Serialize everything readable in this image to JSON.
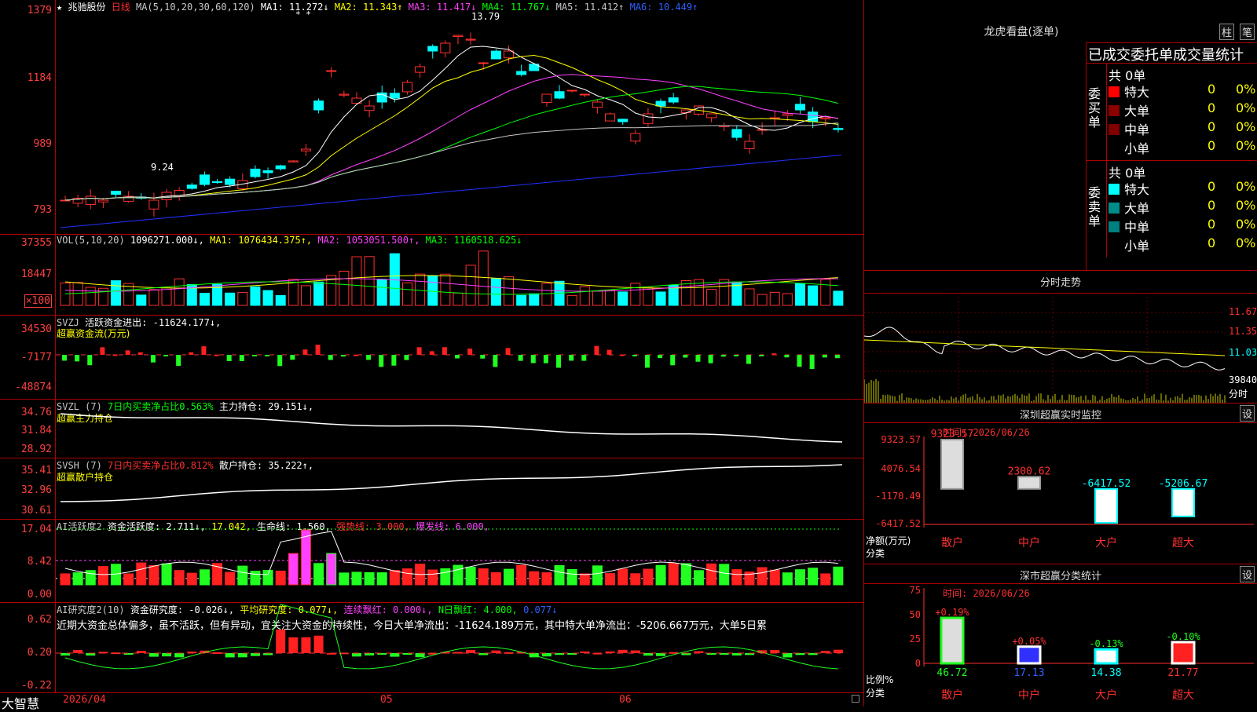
{
  "stock": {
    "star": "★",
    "name": "兆驰股份",
    "period": "日线"
  },
  "ma_header": {
    "label": "MA(5,10,20,30,60,120)",
    "ma1": "MA1: 11.272↓",
    "ma2": "MA2: 11.343↑",
    "ma3": "MA3: 11.417↓",
    "ma4": "MA4: 11.767↓",
    "ma5": "MA5: 11.412↑",
    "ma6": "MA6: 10.449↑"
  },
  "price_axis": [
    "1379",
    "1184",
    "989",
    "793"
  ],
  "price_annotations": {
    "high": "13.79",
    "low": "9.24",
    "marks": "* *"
  },
  "vol_header": {
    "label": "VOL(5,10,20)",
    "value": "1096271.000↓,",
    "ma1": "MA1: 1076434.375↑,",
    "ma2": "MA2: 1053051.500↑,",
    "ma3": "MA3: 1160518.625↓"
  },
  "vol_axis": [
    "37355",
    "18447"
  ],
  "vol_unit": "×100",
  "svzj_header": {
    "label": "SVZJ",
    "title": "活跃资金进出: -11624.177↓,",
    "sub": "超赢资金流(万元)"
  },
  "svzj_axis": [
    "34530",
    "-7177",
    "-48874"
  ],
  "svzl_header": {
    "label": "SVZL (7)",
    "desc": "7日内买卖净占比0.563%",
    "value": "主力持仓: 29.151↓,",
    "sub": "超赢主力持仓"
  },
  "svzl_axis": [
    "34.76",
    "31.84",
    "28.92"
  ],
  "svsh_header": {
    "label": "SVSH (7)",
    "desc": "7日内买卖净占比0.812%",
    "value": "散户持仓: 35.222↑,",
    "sub": "超赢散户持仓"
  },
  "svsh_axis": [
    "35.41",
    "32.96",
    "30.61"
  ],
  "ai1_header": {
    "label": "AI活跃度2",
    "a": "资金活跃度: 2.711↓,",
    "b": "17.042,",
    "c": "生命线: 1.560,",
    "d": "强势线: 3.000,",
    "e": "爆发线: 6.000,"
  },
  "ai1_axis": [
    "17.04",
    "8.42",
    "0.00"
  ],
  "ai2_header": {
    "label": "AI研究度2(10)",
    "a": "资金研究度: -0.026↓,",
    "b": "平均研究度: 0.077↓,",
    "c": "连续飘红: 0.000↓,",
    "d": "N日飘红: 4.000,",
    "e": "0.077↓"
  },
  "ai2_axis": [
    "0.62",
    "0.20",
    "-0.22"
  ],
  "ai2_text": "近期大资金总体偏多，虽不活跃，但有异动，宜关注大资金的持续性，今日大单净流出：-11624.189万元，其中特大单净流出：-5206.667万元，大单5日累",
  "date_axis": {
    "start": "2026/04",
    "m1": "05",
    "m2": "06"
  },
  "brand": "大智慧",
  "lhb": {
    "title": "龙虎看盘(逐单)",
    "btn1": "柱",
    "btn2": "笔",
    "sub": "已成交委托单成交量统计",
    "buy_label": "委买单",
    "sell_label": "委卖单",
    "buy_total": "共 0单",
    "sell_total": "共 0单",
    "buy_rows": [
      {
        "name": "特大",
        "val": "0",
        "pct": "0%"
      },
      {
        "name": "大单",
        "val": "0",
        "pct": "0%"
      },
      {
        "name": "中单",
        "val": "0",
        "pct": "0%"
      },
      {
        "name": "小单",
        "val": "0",
        "pct": "0%"
      }
    ],
    "sell_rows": [
      {
        "name": "特大",
        "val": "0",
        "pct": "0%"
      },
      {
        "name": "大单",
        "val": "0",
        "pct": "0%"
      },
      {
        "name": "中单",
        "val": "0",
        "pct": "0%"
      },
      {
        "name": "小单",
        "val": "0",
        "pct": "0%"
      }
    ],
    "colors": {
      "buy": [
        "#ff0000",
        "#8b0000",
        "#800000"
      ],
      "sell": [
        "#00ffff",
        "#008b8b",
        "#008080"
      ]
    }
  },
  "fenshi": {
    "title": "分时走势",
    "axis": [
      "11.67",
      "11.35",
      "11.03"
    ],
    "vol": "39840",
    "label": "分时"
  },
  "monitor": {
    "title": "深圳超赢实时监控",
    "btn": "设",
    "time": "时间: 2026/06/26",
    "axis": [
      "9323.57",
      "4076.54",
      "-1170.49",
      "-6417.52"
    ],
    "ylabel": "净额(万元)",
    "xlabel": "分类",
    "cats": [
      "散户",
      "中户",
      "大户",
      "超大"
    ],
    "values": [
      "9323.57",
      "2300.62",
      "-6417.52",
      "-5206.67"
    ]
  },
  "classify": {
    "title": "深市超赢分类统计",
    "btn": "设",
    "time": "时间: 2026/06/26",
    "axis": [
      "75",
      "50",
      "25",
      "0"
    ],
    "ylabel": "比例%",
    "xlabel": "分类",
    "cats": [
      "散户",
      "中户",
      "大户",
      "超大"
    ],
    "top": [
      "+0.19%",
      "+0.05%",
      "-0.13%",
      "-0.10%"
    ],
    "bottom": [
      "46.72",
      "17.13",
      "14.38",
      "21.77"
    ]
  },
  "chart_data": [
    {
      "type": "bar",
      "title": "深圳超赢实时监控",
      "categories": [
        "散户",
        "中户",
        "大户",
        "超大"
      ],
      "values": [
        9323.57,
        2300.62,
        -6417.52,
        -5206.67
      ],
      "ylabel": "净额(万元)",
      "ylim": [
        -6417.52,
        9323.57
      ]
    },
    {
      "type": "bar",
      "title": "深市超赢分类统计",
      "categories": [
        "散户",
        "中户",
        "大户",
        "超大"
      ],
      "values": [
        46.72,
        17.13,
        14.38,
        21.77
      ],
      "ylabel": "比例%",
      "ylim": [
        0,
        75
      ]
    }
  ]
}
